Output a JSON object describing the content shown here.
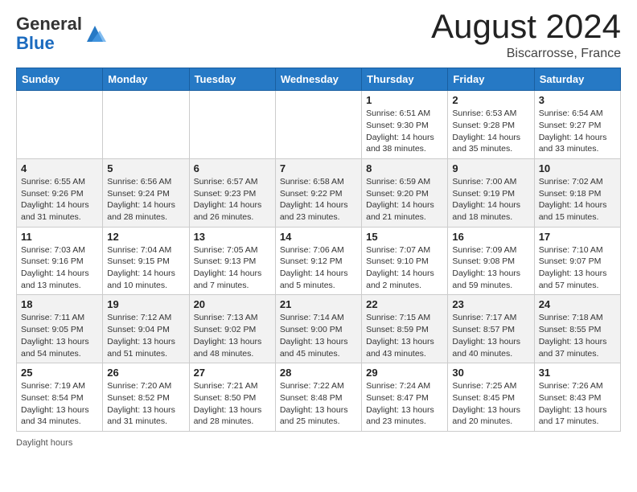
{
  "header": {
    "logo_general": "General",
    "logo_blue": "Blue",
    "month_title": "August 2024",
    "location": "Biscarrosse, France"
  },
  "days_of_week": [
    "Sunday",
    "Monday",
    "Tuesday",
    "Wednesday",
    "Thursday",
    "Friday",
    "Saturday"
  ],
  "weeks": [
    [
      {
        "day": "",
        "info": ""
      },
      {
        "day": "",
        "info": ""
      },
      {
        "day": "",
        "info": ""
      },
      {
        "day": "",
        "info": ""
      },
      {
        "day": "1",
        "info": "Sunrise: 6:51 AM\nSunset: 9:30 PM\nDaylight: 14 hours\nand 38 minutes."
      },
      {
        "day": "2",
        "info": "Sunrise: 6:53 AM\nSunset: 9:28 PM\nDaylight: 14 hours\nand 35 minutes."
      },
      {
        "day": "3",
        "info": "Sunrise: 6:54 AM\nSunset: 9:27 PM\nDaylight: 14 hours\nand 33 minutes."
      }
    ],
    [
      {
        "day": "4",
        "info": "Sunrise: 6:55 AM\nSunset: 9:26 PM\nDaylight: 14 hours\nand 31 minutes."
      },
      {
        "day": "5",
        "info": "Sunrise: 6:56 AM\nSunset: 9:24 PM\nDaylight: 14 hours\nand 28 minutes."
      },
      {
        "day": "6",
        "info": "Sunrise: 6:57 AM\nSunset: 9:23 PM\nDaylight: 14 hours\nand 26 minutes."
      },
      {
        "day": "7",
        "info": "Sunrise: 6:58 AM\nSunset: 9:22 PM\nDaylight: 14 hours\nand 23 minutes."
      },
      {
        "day": "8",
        "info": "Sunrise: 6:59 AM\nSunset: 9:20 PM\nDaylight: 14 hours\nand 21 minutes."
      },
      {
        "day": "9",
        "info": "Sunrise: 7:00 AM\nSunset: 9:19 PM\nDaylight: 14 hours\nand 18 minutes."
      },
      {
        "day": "10",
        "info": "Sunrise: 7:02 AM\nSunset: 9:18 PM\nDaylight: 14 hours\nand 15 minutes."
      }
    ],
    [
      {
        "day": "11",
        "info": "Sunrise: 7:03 AM\nSunset: 9:16 PM\nDaylight: 14 hours\nand 13 minutes."
      },
      {
        "day": "12",
        "info": "Sunrise: 7:04 AM\nSunset: 9:15 PM\nDaylight: 14 hours\nand 10 minutes."
      },
      {
        "day": "13",
        "info": "Sunrise: 7:05 AM\nSunset: 9:13 PM\nDaylight: 14 hours\nand 7 minutes."
      },
      {
        "day": "14",
        "info": "Sunrise: 7:06 AM\nSunset: 9:12 PM\nDaylight: 14 hours\nand 5 minutes."
      },
      {
        "day": "15",
        "info": "Sunrise: 7:07 AM\nSunset: 9:10 PM\nDaylight: 14 hours\nand 2 minutes."
      },
      {
        "day": "16",
        "info": "Sunrise: 7:09 AM\nSunset: 9:08 PM\nDaylight: 13 hours\nand 59 minutes."
      },
      {
        "day": "17",
        "info": "Sunrise: 7:10 AM\nSunset: 9:07 PM\nDaylight: 13 hours\nand 57 minutes."
      }
    ],
    [
      {
        "day": "18",
        "info": "Sunrise: 7:11 AM\nSunset: 9:05 PM\nDaylight: 13 hours\nand 54 minutes."
      },
      {
        "day": "19",
        "info": "Sunrise: 7:12 AM\nSunset: 9:04 PM\nDaylight: 13 hours\nand 51 minutes."
      },
      {
        "day": "20",
        "info": "Sunrise: 7:13 AM\nSunset: 9:02 PM\nDaylight: 13 hours\nand 48 minutes."
      },
      {
        "day": "21",
        "info": "Sunrise: 7:14 AM\nSunset: 9:00 PM\nDaylight: 13 hours\nand 45 minutes."
      },
      {
        "day": "22",
        "info": "Sunrise: 7:15 AM\nSunset: 8:59 PM\nDaylight: 13 hours\nand 43 minutes."
      },
      {
        "day": "23",
        "info": "Sunrise: 7:17 AM\nSunset: 8:57 PM\nDaylight: 13 hours\nand 40 minutes."
      },
      {
        "day": "24",
        "info": "Sunrise: 7:18 AM\nSunset: 8:55 PM\nDaylight: 13 hours\nand 37 minutes."
      }
    ],
    [
      {
        "day": "25",
        "info": "Sunrise: 7:19 AM\nSunset: 8:54 PM\nDaylight: 13 hours\nand 34 minutes."
      },
      {
        "day": "26",
        "info": "Sunrise: 7:20 AM\nSunset: 8:52 PM\nDaylight: 13 hours\nand 31 minutes."
      },
      {
        "day": "27",
        "info": "Sunrise: 7:21 AM\nSunset: 8:50 PM\nDaylight: 13 hours\nand 28 minutes."
      },
      {
        "day": "28",
        "info": "Sunrise: 7:22 AM\nSunset: 8:48 PM\nDaylight: 13 hours\nand 25 minutes."
      },
      {
        "day": "29",
        "info": "Sunrise: 7:24 AM\nSunset: 8:47 PM\nDaylight: 13 hours\nand 23 minutes."
      },
      {
        "day": "30",
        "info": "Sunrise: 7:25 AM\nSunset: 8:45 PM\nDaylight: 13 hours\nand 20 minutes."
      },
      {
        "day": "31",
        "info": "Sunrise: 7:26 AM\nSunset: 8:43 PM\nDaylight: 13 hours\nand 17 minutes."
      }
    ]
  ],
  "footer": {
    "daylight_label": "Daylight hours"
  }
}
